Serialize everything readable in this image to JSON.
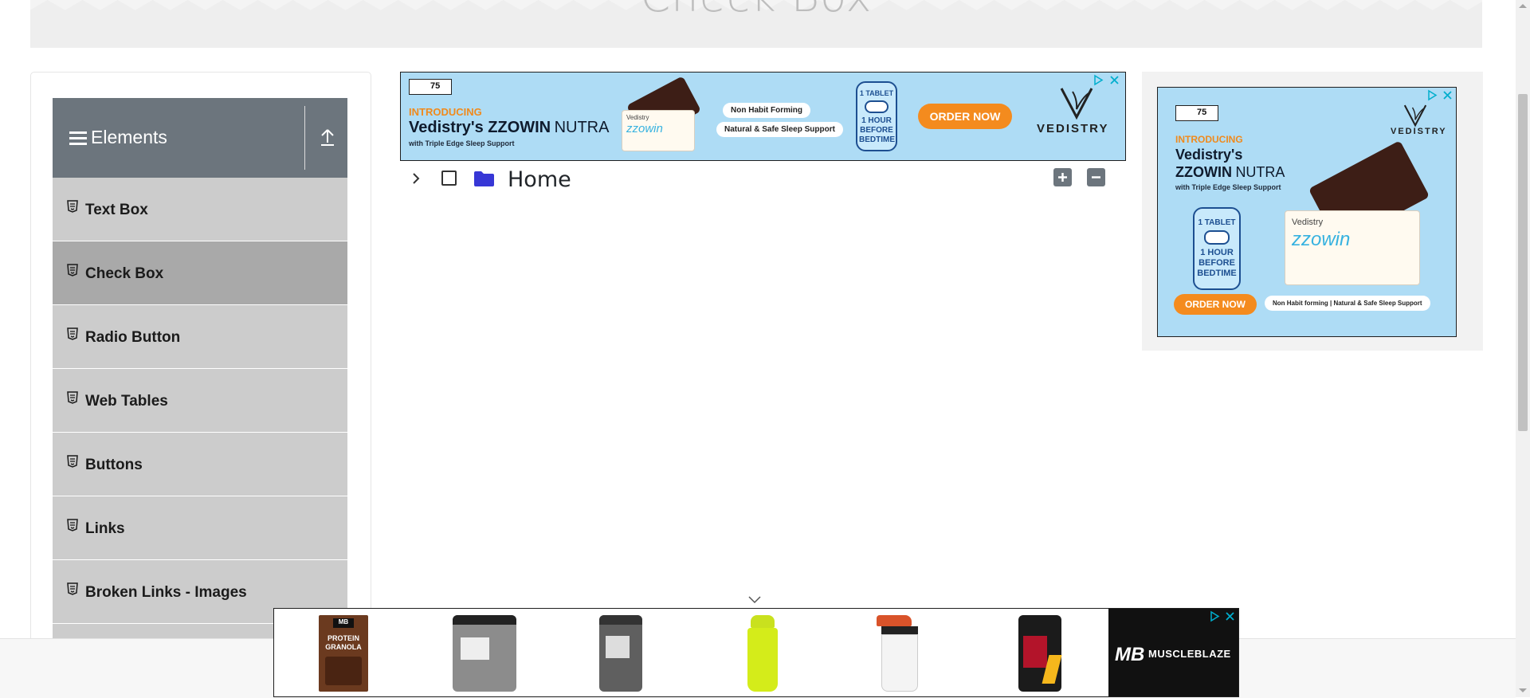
{
  "page": {
    "title": "Check Box"
  },
  "sidebar": {
    "group_title": "Elements",
    "items": [
      {
        "label": "Text Box"
      },
      {
        "label": "Check Box"
      },
      {
        "label": "Radio Button"
      },
      {
        "label": "Web Tables"
      },
      {
        "label": "Buttons"
      },
      {
        "label": "Links"
      },
      {
        "label": "Broken Links - Images"
      }
    ],
    "active_item": "Check Box"
  },
  "tree": {
    "root_label": "Home"
  },
  "ads": {
    "top": {
      "brand_tag": "75",
      "introducing": "INTRODUCING",
      "headline_bold": "Vedistry's ZZOWIN",
      "headline_light": "NUTRA",
      "sub": "with Triple Edge Sleep Support",
      "pill_1": "Non Habit Forming",
      "pill_2": "Natural & Safe Sleep Support",
      "tablet_1": "1 TABLET",
      "tablet_2": "1 HOUR BEFORE BEDTIME",
      "cta": "ORDER NOW",
      "brand": "VEDISTRY",
      "pack_brand": "Vedistry",
      "pack_name": "zzowin"
    },
    "right": {
      "brand_tag": "75",
      "introducing": "INTRODUCING",
      "headline_1": "Vedistry's",
      "headline_2": "ZZOWIN",
      "headline_3": "NUTRA",
      "sub": "with Triple Edge Sleep Support",
      "tablet_1": "1 TABLET",
      "tablet_2": "1 HOUR BEFORE BEDTIME",
      "cta": "ORDER NOW",
      "footer_text": "Non Habit forming  |  Natural & Safe Sleep Support",
      "brand": "VEDISTRY",
      "pack_brand": "Vedistry",
      "pack_name": "zzowin"
    },
    "bottom": {
      "brand_mark": "MB",
      "brand_name": "MUSCLEBLAZE",
      "granola_line_1": "PROTEIN",
      "granola_line_2": "GRANOLA",
      "products": [
        "granola-box",
        "whey-tub-grey",
        "whey-tub-dark",
        "shaker-lime",
        "shaker-white",
        "whey-tub-red"
      ]
    }
  },
  "colors": {
    "sidebar_header": "#6c757d",
    "menu_item": "#cccccc",
    "menu_item_active": "#a9a9a9",
    "ad_background": "#aedcf5",
    "cta_orange": "#f48b1e",
    "folder_blue": "#3737d6"
  }
}
